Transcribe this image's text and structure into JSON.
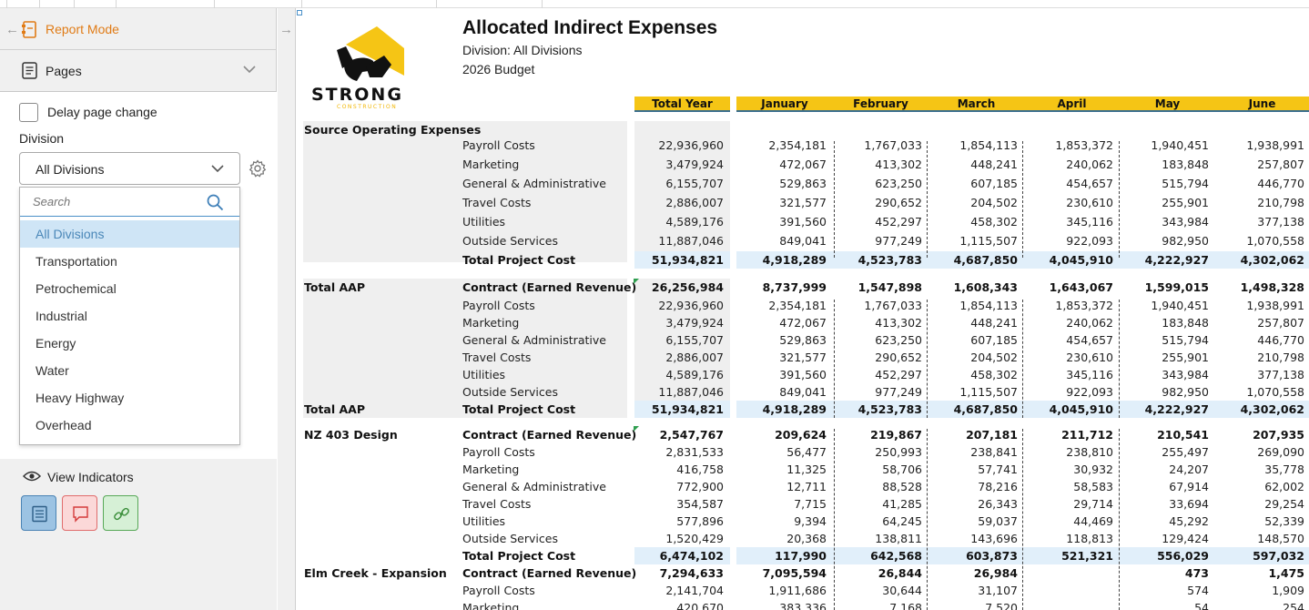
{
  "left": {
    "report_mode_label": "Report Mode",
    "pages_label": "Pages",
    "delay_label": "Delay page change",
    "division_label": "Division",
    "division_value": "All Divisions",
    "search_placeholder": "Search",
    "options": [
      "All Divisions",
      "Transportation",
      "Petrochemical",
      "Industrial",
      "Energy",
      "Water",
      "Heavy Highway",
      "Overhead"
    ],
    "view_indicators_label": "View Indicators"
  },
  "report": {
    "logo_text": "STRONG",
    "logo_sub": "CONSTRUCTION",
    "title": "Allocated Indirect Expenses",
    "subtitle1": "Division: All Divisions",
    "subtitle2": "2026 Budget",
    "columns": [
      "Total Year",
      "January",
      "February",
      "March",
      "April",
      "May",
      "June"
    ],
    "sections": [
      {
        "name": "Source Operating Expenses",
        "rows": [
          {
            "label": "Payroll Costs",
            "values": [
              "22,936,960",
              "2,354,181",
              "1,767,033",
              "1,854,113",
              "1,853,372",
              "1,940,451",
              "1,938,991"
            ]
          },
          {
            "label": "Marketing",
            "values": [
              "3,479,924",
              "472,067",
              "413,302",
              "448,241",
              "240,062",
              "183,848",
              "257,807"
            ]
          },
          {
            "label": "General & Administrative",
            "values": [
              "6,155,707",
              "529,863",
              "623,250",
              "607,185",
              "454,657",
              "515,794",
              "446,770"
            ]
          },
          {
            "label": "Travel Costs",
            "values": [
              "2,886,007",
              "321,577",
              "290,652",
              "204,502",
              "230,610",
              "255,901",
              "210,798"
            ]
          },
          {
            "label": "Utilities",
            "values": [
              "4,589,176",
              "391,560",
              "452,297",
              "458,302",
              "345,116",
              "343,984",
              "377,138"
            ]
          },
          {
            "label": "Outside Services",
            "values": [
              "11,887,046",
              "849,041",
              "977,249",
              "1,115,507",
              "922,093",
              "982,950",
              "1,070,558"
            ]
          },
          {
            "label": "Total Project Cost",
            "values": [
              "51,934,821",
              "4,918,289",
              "4,523,783",
              "4,687,850",
              "4,045,910",
              "4,222,927",
              "4,302,062"
            ]
          }
        ]
      },
      {
        "name": "Total AAP",
        "rows": [
          {
            "label": "Contract (Earned Revenue)",
            "values": [
              "26,256,984",
              "8,737,999",
              "1,547,898",
              "1,608,343",
              "1,643,067",
              "1,599,015",
              "1,498,328"
            ]
          },
          {
            "label": "Payroll Costs",
            "values": [
              "22,936,960",
              "2,354,181",
              "1,767,033",
              "1,854,113",
              "1,853,372",
              "1,940,451",
              "1,938,991"
            ]
          },
          {
            "label": "Marketing",
            "values": [
              "3,479,924",
              "472,067",
              "413,302",
              "448,241",
              "240,062",
              "183,848",
              "257,807"
            ]
          },
          {
            "label": "General & Administrative",
            "values": [
              "6,155,707",
              "529,863",
              "623,250",
              "607,185",
              "454,657",
              "515,794",
              "446,770"
            ]
          },
          {
            "label": "Travel Costs",
            "values": [
              "2,886,007",
              "321,577",
              "290,652",
              "204,502",
              "230,610",
              "255,901",
              "210,798"
            ]
          },
          {
            "label": "Utilities",
            "values": [
              "4,589,176",
              "391,560",
              "452,297",
              "458,302",
              "345,116",
              "343,984",
              "377,138"
            ]
          },
          {
            "label": "Outside Services",
            "values": [
              "11,887,046",
              "849,041",
              "977,249",
              "1,115,507",
              "922,093",
              "982,950",
              "1,070,558"
            ]
          },
          {
            "label": "Total Project Cost",
            "total_name": "Total AAP",
            "values": [
              "51,934,821",
              "4,918,289",
              "4,523,783",
              "4,687,850",
              "4,045,910",
              "4,222,927",
              "4,302,062"
            ]
          }
        ]
      },
      {
        "name": "NZ 403 Design",
        "rows": [
          {
            "label": "Contract (Earned Revenue)",
            "values": [
              "2,547,767",
              "209,624",
              "219,867",
              "207,181",
              "211,712",
              "210,541",
              "207,935"
            ]
          },
          {
            "label": "Payroll Costs",
            "values": [
              "2,831,533",
              "56,477",
              "250,993",
              "238,841",
              "238,810",
              "255,497",
              "269,090"
            ]
          },
          {
            "label": "Marketing",
            "values": [
              "416,758",
              "11,325",
              "58,706",
              "57,741",
              "30,932",
              "24,207",
              "35,778"
            ]
          },
          {
            "label": "General & Administrative",
            "values": [
              "772,900",
              "12,711",
              "88,528",
              "78,216",
              "58,583",
              "67,914",
              "62,002"
            ]
          },
          {
            "label": "Travel Costs",
            "values": [
              "354,587",
              "7,715",
              "41,285",
              "26,343",
              "29,714",
              "33,694",
              "29,254"
            ]
          },
          {
            "label": "Utilities",
            "values": [
              "577,896",
              "9,394",
              "64,245",
              "59,037",
              "44,469",
              "45,292",
              "52,339"
            ]
          },
          {
            "label": "Outside Services",
            "values": [
              "1,520,429",
              "20,368",
              "138,811",
              "143,696",
              "118,813",
              "129,424",
              "148,570"
            ]
          },
          {
            "label": "Total Project Cost",
            "values": [
              "6,474,102",
              "117,990",
              "642,568",
              "603,873",
              "521,321",
              "556,029",
              "597,032"
            ]
          }
        ]
      },
      {
        "name": "Elm Creek - Expansion",
        "rows": [
          {
            "label": "Contract (Earned Revenue)",
            "values": [
              "7,294,633",
              "7,095,594",
              "26,844",
              "26,984",
              "",
              "473",
              "1,475"
            ]
          },
          {
            "label": "Payroll Costs",
            "values": [
              "2,141,704",
              "1,911,686",
              "30,644",
              "31,107",
              "",
              "574",
              "1,909"
            ]
          },
          {
            "label": "Marketing",
            "values": [
              "420,670",
              "383,336",
              "7,168",
              "7,520",
              "",
              "54",
              "254"
            ]
          }
        ]
      }
    ]
  }
}
